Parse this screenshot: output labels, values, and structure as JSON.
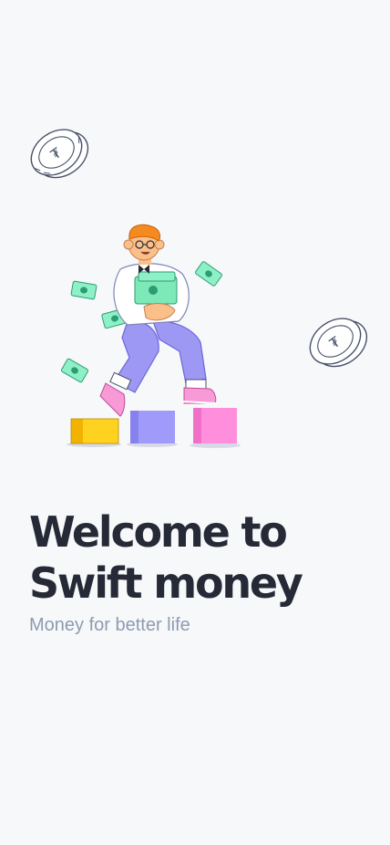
{
  "welcome": {
    "title_line1": "Welcome to",
    "title_line2": "Swift money",
    "subtitle": "Money for better life"
  },
  "illustration": {
    "icons": [
      "coin-icon",
      "banknote-icon",
      "person-carrying-money",
      "block-steps"
    ]
  },
  "colors": {
    "background": "#f7f8fa",
    "title": "#262a36",
    "subtitle": "#8d9bb1",
    "money_green": "#7de8b8",
    "pants_purple": "#9e98f5",
    "shoe_pink": "#f79ad6",
    "block_yellow": "#ffd21f",
    "block_purple": "#a09bfa",
    "block_pink": "#ff8fdc",
    "hair_orange": "#f58a1f"
  }
}
